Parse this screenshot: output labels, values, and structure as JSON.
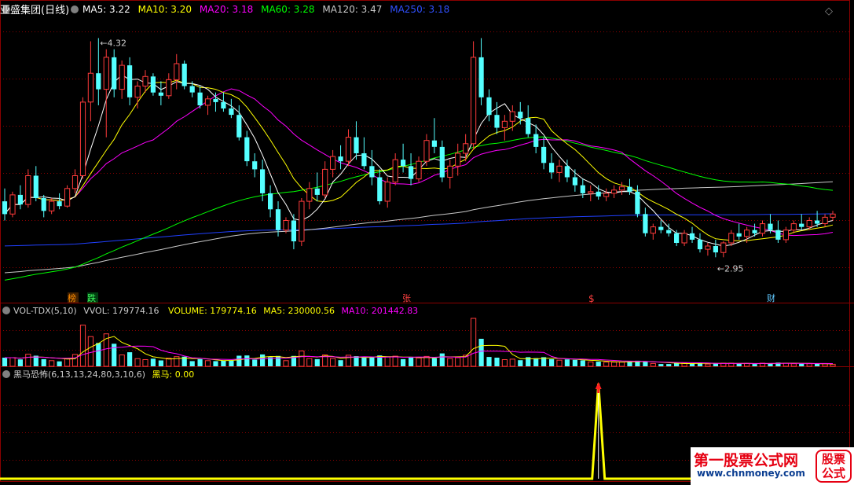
{
  "colors": {
    "background": "#000000",
    "up": "#ff3b3b",
    "down": "#54ffff",
    "ma5": "#ffffff",
    "ma10": "#ffff00",
    "ma20": "#ff00ff",
    "ma60": "#00ff00",
    "ma120": "#c8c8c8",
    "ma250": "#2040ff",
    "grid": "#8b0000",
    "heima": "#ffff00"
  },
  "main_panel": {
    "title": "亚盛集团(日线)",
    "ma_labels": [
      {
        "key": "ma5",
        "text": "MA5: 3.22"
      },
      {
        "key": "ma10",
        "text": "MA10: 3.20"
      },
      {
        "key": "ma20",
        "text": "MA20: 3.18"
      },
      {
        "key": "ma60",
        "text": "MA60: 3.28"
      },
      {
        "key": "ma120",
        "text": "MA120: 3.47"
      },
      {
        "key": "ma250",
        "text": "MA250: 3.18"
      }
    ],
    "high_marker": "4.32",
    "low_marker": "2.95",
    "event_tags": [
      "榜",
      "跌",
      "张",
      "$",
      "财"
    ]
  },
  "vol_panel": {
    "label_name": "VOL-TDX(5,10)",
    "vvol": "VVOL: 179774.16",
    "volume": "VOLUME: 179774.16",
    "ma5": "MA5: 230000.56",
    "ma10": "MA10: 201442.83"
  },
  "heima_panel": {
    "label_name": "黑马恐怖(6,13,13,24,80,3,10,6)",
    "value": "黑马: 0.00"
  },
  "watermark": {
    "name": "第一股票公式网",
    "url": "www.chnmoney.com",
    "badge_top": "股票",
    "badge_bottom": "公式"
  },
  "chart_data": {
    "type": "candlestick",
    "ylim": [
      2.75,
      4.45
    ],
    "price_markers": {
      "high": 4.32,
      "low": 2.95
    },
    "candles": [
      [
        3.3,
        3.38,
        3.18,
        3.22
      ],
      [
        3.22,
        3.36,
        3.2,
        3.34
      ],
      [
        3.34,
        3.4,
        3.25,
        3.28
      ],
      [
        3.28,
        3.5,
        3.26,
        3.46
      ],
      [
        3.46,
        3.52,
        3.3,
        3.32
      ],
      [
        3.32,
        3.34,
        3.2,
        3.24
      ],
      [
        3.24,
        3.32,
        3.22,
        3.3
      ],
      [
        3.3,
        3.35,
        3.25,
        3.27
      ],
      [
        3.27,
        3.4,
        3.26,
        3.38
      ],
      [
        3.38,
        3.5,
        3.35,
        3.46
      ],
      [
        3.46,
        3.95,
        3.44,
        3.92
      ],
      [
        3.92,
        4.3,
        3.8,
        4.1
      ],
      [
        4.1,
        4.32,
        3.9,
        4.0
      ],
      [
        4.0,
        4.25,
        3.7,
        4.2
      ],
      [
        4.2,
        4.25,
        3.95,
        4.0
      ],
      [
        4.0,
        4.18,
        3.94,
        4.15
      ],
      [
        4.15,
        4.2,
        3.9,
        3.95
      ],
      [
        3.95,
        4.05,
        3.88,
        4.02
      ],
      [
        4.02,
        4.12,
        3.98,
        4.08
      ],
      [
        4.08,
        4.1,
        3.96,
        3.98
      ],
      [
        3.98,
        4.05,
        3.9,
        3.96
      ],
      [
        3.96,
        4.1,
        3.94,
        4.06
      ],
      [
        4.06,
        4.22,
        4.0,
        4.16
      ],
      [
        4.16,
        4.18,
        4.0,
        4.02
      ],
      [
        4.02,
        4.05,
        3.95,
        3.98
      ],
      [
        3.98,
        4.02,
        3.88,
        3.9
      ],
      [
        3.9,
        3.96,
        3.84,
        3.94
      ],
      [
        3.94,
        3.98,
        3.86,
        3.92
      ],
      [
        3.92,
        3.98,
        3.86,
        3.88
      ],
      [
        3.88,
        3.94,
        3.82,
        3.84
      ],
      [
        3.84,
        3.9,
        3.68,
        3.7
      ],
      [
        3.7,
        3.74,
        3.52,
        3.55
      ],
      [
        3.55,
        3.6,
        3.45,
        3.5
      ],
      [
        3.5,
        3.56,
        3.3,
        3.35
      ],
      [
        3.35,
        3.4,
        3.2,
        3.25
      ],
      [
        3.25,
        3.3,
        3.08,
        3.12
      ],
      [
        3.12,
        3.2,
        3.1,
        3.18
      ],
      [
        3.18,
        3.22,
        3.0,
        3.05
      ],
      [
        3.05,
        3.32,
        3.02,
        3.3
      ],
      [
        3.3,
        3.42,
        3.25,
        3.38
      ],
      [
        3.38,
        3.48,
        3.3,
        3.34
      ],
      [
        3.34,
        3.55,
        3.32,
        3.5
      ],
      [
        3.5,
        3.62,
        3.45,
        3.58
      ],
      [
        3.58,
        3.65,
        3.5,
        3.55
      ],
      [
        3.55,
        3.75,
        3.52,
        3.7
      ],
      [
        3.7,
        3.8,
        3.56,
        3.6
      ],
      [
        3.6,
        3.7,
        3.5,
        3.52
      ],
      [
        3.52,
        3.62,
        3.4,
        3.45
      ],
      [
        3.45,
        3.5,
        3.28,
        3.3
      ],
      [
        3.3,
        3.45,
        3.26,
        3.42
      ],
      [
        3.42,
        3.6,
        3.4,
        3.56
      ],
      [
        3.56,
        3.66,
        3.48,
        3.52
      ],
      [
        3.52,
        3.6,
        3.4,
        3.44
      ],
      [
        3.44,
        3.58,
        3.42,
        3.55
      ],
      [
        3.55,
        3.72,
        3.52,
        3.68
      ],
      [
        3.68,
        3.82,
        3.6,
        3.64
      ],
      [
        3.64,
        3.68,
        3.42,
        3.45
      ],
      [
        3.45,
        3.56,
        3.38,
        3.52
      ],
      [
        3.52,
        3.66,
        3.46,
        3.6
      ],
      [
        3.6,
        3.72,
        3.55,
        3.66
      ],
      [
        3.66,
        4.3,
        3.62,
        4.2
      ],
      [
        4.2,
        4.32,
        3.9,
        3.95
      ],
      [
        3.95,
        4.0,
        3.8,
        3.84
      ],
      [
        3.84,
        3.92,
        3.72,
        3.76
      ],
      [
        3.76,
        3.84,
        3.68,
        3.8
      ],
      [
        3.8,
        3.9,
        3.74,
        3.86
      ],
      [
        3.86,
        3.92,
        3.78,
        3.82
      ],
      [
        3.82,
        3.9,
        3.7,
        3.72
      ],
      [
        3.72,
        3.78,
        3.6,
        3.64
      ],
      [
        3.64,
        3.7,
        3.5,
        3.54
      ],
      [
        3.54,
        3.6,
        3.44,
        3.48
      ],
      [
        3.48,
        3.56,
        3.42,
        3.52
      ],
      [
        3.52,
        3.56,
        3.42,
        3.45
      ],
      [
        3.45,
        3.5,
        3.36,
        3.4
      ],
      [
        3.4,
        3.44,
        3.32,
        3.35
      ],
      [
        3.35,
        3.4,
        3.3,
        3.36
      ],
      [
        3.36,
        3.4,
        3.31,
        3.33
      ],
      [
        3.33,
        3.38,
        3.3,
        3.35
      ],
      [
        3.35,
        3.4,
        3.32,
        3.37
      ],
      [
        3.37,
        3.42,
        3.34,
        3.39
      ],
      [
        3.39,
        3.44,
        3.34,
        3.36
      ],
      [
        3.36,
        3.4,
        3.2,
        3.22
      ],
      [
        3.22,
        3.26,
        3.08,
        3.1
      ],
      [
        3.1,
        3.16,
        3.06,
        3.14
      ],
      [
        3.14,
        3.18,
        3.1,
        3.12
      ],
      [
        3.12,
        3.16,
        3.08,
        3.1
      ],
      [
        3.1,
        3.12,
        3.02,
        3.04
      ],
      [
        3.04,
        3.12,
        3.02,
        3.1
      ],
      [
        3.1,
        3.14,
        3.04,
        3.06
      ],
      [
        3.06,
        3.1,
        2.98,
        3.0
      ],
      [
        3.0,
        3.04,
        2.96,
        3.02
      ],
      [
        3.02,
        3.06,
        2.95,
        2.98
      ],
      [
        2.98,
        3.05,
        2.95,
        3.04
      ],
      [
        3.04,
        3.12,
        3.02,
        3.1
      ],
      [
        3.1,
        3.16,
        3.06,
        3.08
      ],
      [
        3.08,
        3.14,
        3.04,
        3.12
      ],
      [
        3.12,
        3.16,
        3.08,
        3.1
      ],
      [
        3.1,
        3.18,
        3.08,
        3.16
      ],
      [
        3.16,
        3.22,
        3.1,
        3.12
      ],
      [
        3.12,
        3.18,
        3.04,
        3.06
      ],
      [
        3.06,
        3.14,
        3.04,
        3.12
      ],
      [
        3.12,
        3.18,
        3.1,
        3.16
      ],
      [
        3.16,
        3.22,
        3.12,
        3.14
      ],
      [
        3.14,
        3.2,
        3.12,
        3.18
      ],
      [
        3.18,
        3.24,
        3.14,
        3.16
      ],
      [
        3.16,
        3.22,
        3.14,
        3.2
      ],
      [
        3.2,
        3.24,
        3.18,
        3.22
      ]
    ],
    "volume_panel": {
      "series_names": [
        "VVOL",
        "VOLUME",
        "MA5",
        "MA10"
      ],
      "latest": {
        "VVOL": 179774.16,
        "VOLUME": 179774.16,
        "MA5": 230000.56,
        "MA10": 201442.83
      }
    },
    "heima": {
      "latest": 0.0,
      "signal_index": 76,
      "signal_level": 1.0,
      "baseline": 0.0
    }
  }
}
